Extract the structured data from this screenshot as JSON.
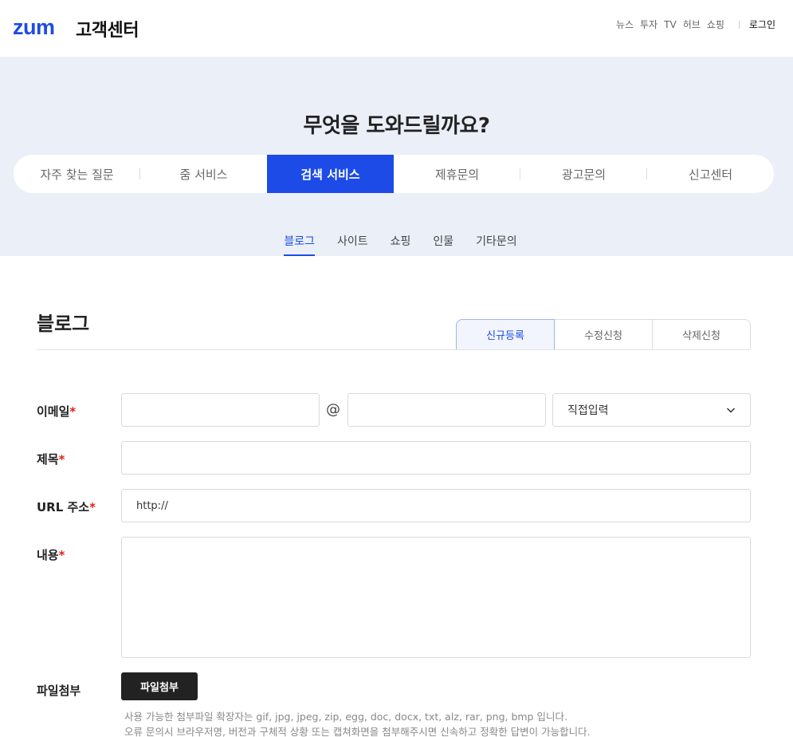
{
  "header": {
    "logo": "zum",
    "title": "고객센터",
    "nav": [
      "뉴스",
      "투자",
      "TV",
      "허브",
      "쇼핑"
    ],
    "login": "로그인"
  },
  "hero": {
    "title": "무엇을 도와드릴까요?",
    "category_tabs": [
      "자주 찾는 질문",
      "줌 서비스",
      "검색 서비스",
      "제휴문의",
      "광고문의",
      "신고센터"
    ],
    "active_category": "검색 서비스",
    "sub_tabs": [
      "블로그",
      "사이트",
      "쇼핑",
      "인물",
      "기타문의"
    ],
    "active_sub_tab": "블로그"
  },
  "section": {
    "title": "블로그",
    "reg_tabs": [
      "신규등록",
      "수정신청",
      "삭제신청"
    ],
    "active_reg_tab": "신규등록"
  },
  "form": {
    "email_label": "이메일",
    "email_local_value": "",
    "email_at": "@",
    "email_domain_value": "",
    "email_domain_select": "직접입력",
    "subject_label": "제목",
    "subject_value": "",
    "url_label": "URL 주소",
    "url_value": "http://",
    "content_label": "내용",
    "content_value": "",
    "attach_label": "파일첨부",
    "attach_button": "파일첨부",
    "required_mark": "*",
    "notes": [
      "사용 가능한 첨부파일 확장자는 gif, jpg, jpeg, zip, egg, doc, docx, txt, alz, rar, png, bmp 입니다.",
      "오류 문의시 브라우저명, 버전과 구체적 상황 또는 캡쳐화면을 첨부해주시면 신속하고 정확한 답변이 가능합니다."
    ]
  },
  "colors": {
    "accent": "#1c4be7",
    "hero_bg": "#ebeff8",
    "required": "#e02020"
  }
}
